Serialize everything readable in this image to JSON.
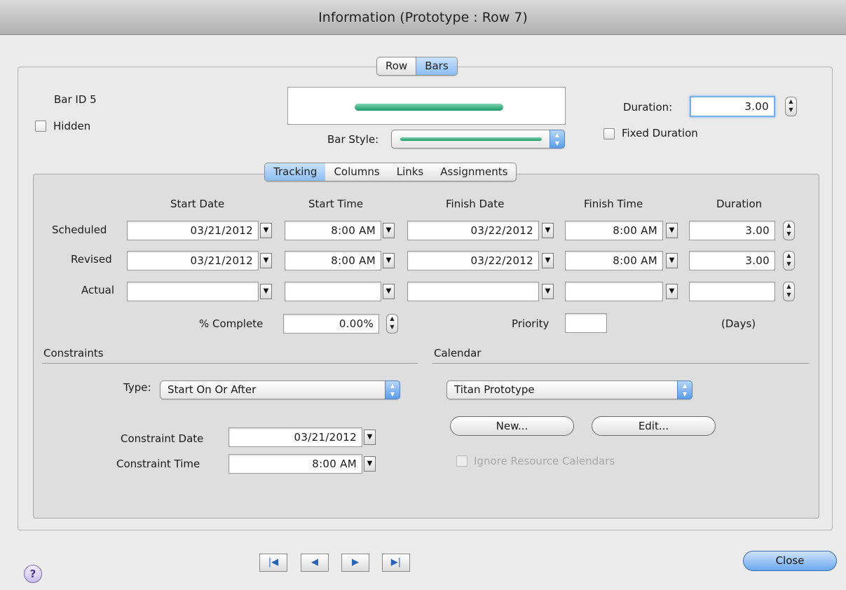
{
  "window": {
    "title": "Information (Prototype : Row 7)"
  },
  "top_tabs": [
    {
      "label": "Row",
      "selected": false
    },
    {
      "label": "Bars",
      "selected": true
    }
  ],
  "bar": {
    "id_label": "Bar ID 5",
    "hidden_label": "Hidden",
    "hidden_checked": false,
    "bar_style_label": "Bar Style:",
    "bar_color": "#2aa574",
    "duration_label": "Duration:",
    "duration_value": "3.00",
    "fixed_duration_label": "Fixed Duration",
    "fixed_duration_checked": false
  },
  "sub_tabs": [
    {
      "label": "Tracking",
      "selected": true
    },
    {
      "label": "Columns",
      "selected": false
    },
    {
      "label": "Links",
      "selected": false
    },
    {
      "label": "Assignments",
      "selected": false
    }
  ],
  "tracking": {
    "headers": {
      "start_date": "Start Date",
      "start_time": "Start Time",
      "finish_date": "Finish Date",
      "finish_time": "Finish Time",
      "duration": "Duration"
    },
    "rows": [
      {
        "label": "Scheduled",
        "start_date": "03/21/2012",
        "start_time": "8:00 AM",
        "finish_date": "03/22/2012",
        "finish_time": "8:00 AM",
        "duration": "3.00"
      },
      {
        "label": "Revised",
        "start_date": "03/21/2012",
        "start_time": "8:00 AM",
        "finish_date": "03/22/2012",
        "finish_time": "8:00 AM",
        "duration": "3.00"
      },
      {
        "label": "Actual",
        "start_date": "",
        "start_time": "",
        "finish_date": "",
        "finish_time": "",
        "duration": ""
      }
    ],
    "percent_complete_label": "% Complete",
    "percent_complete_value": "0.00%",
    "priority_label": "Priority",
    "priority_value": "",
    "days_label": "(Days)"
  },
  "constraints": {
    "section_label": "Constraints",
    "type_label": "Type:",
    "type_value": "Start On Or After",
    "date_label": "Constraint Date",
    "date_value": "03/21/2012",
    "time_label": "Constraint Time",
    "time_value": "8:00 AM"
  },
  "calendar": {
    "section_label": "Calendar",
    "value": "Titan Prototype",
    "new_label": "New...",
    "edit_label": "Edit...",
    "ignore_label": "Ignore Resource Calendars",
    "ignore_checked": false,
    "ignore_disabled": true
  },
  "footer": {
    "help_label": "?",
    "close_label": "Close"
  }
}
